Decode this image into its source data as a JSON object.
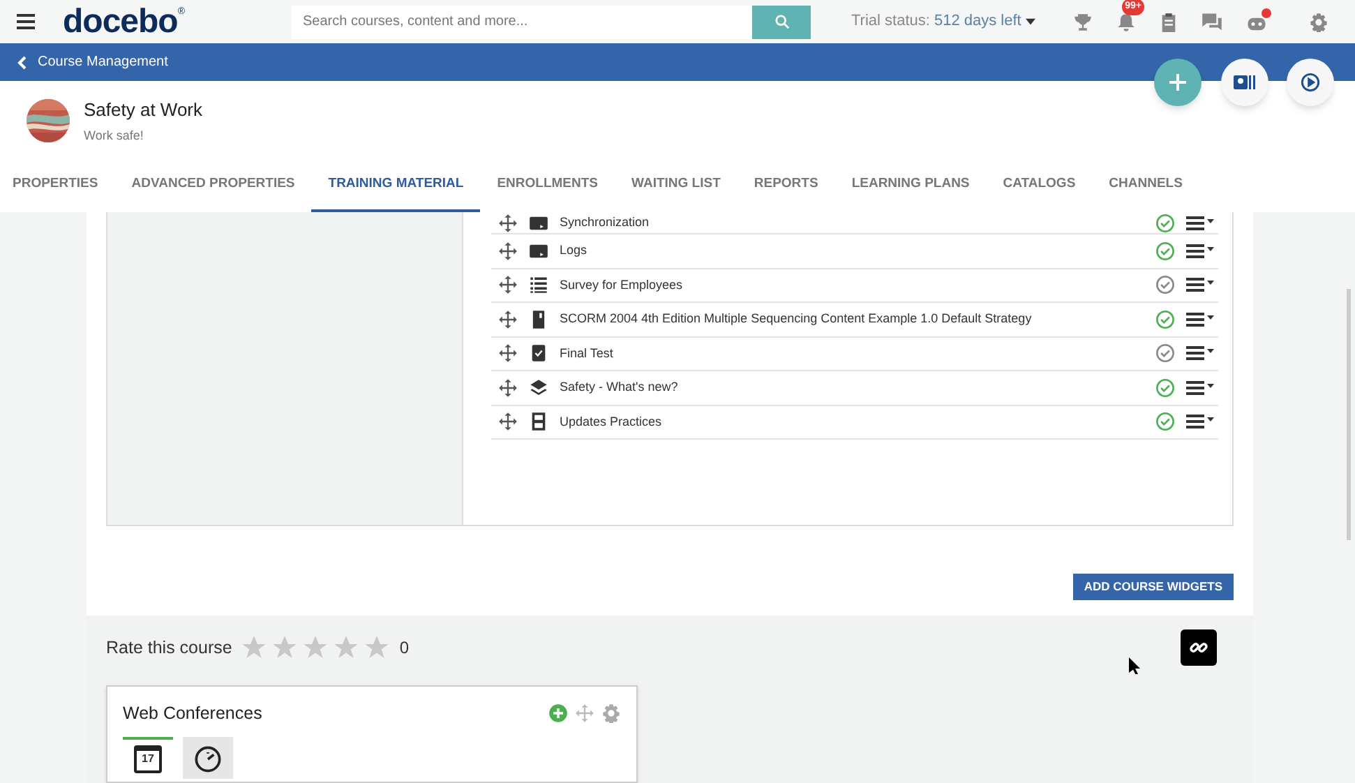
{
  "topbar": {
    "logo": "docebo",
    "logo_mark": "®",
    "search": {
      "placeholder": "Search courses, content and more..."
    },
    "trial_label": "Trial status:",
    "trial_value": "512 days left",
    "notification_badge": "99+"
  },
  "breadcrumb": {
    "label": "Course Management"
  },
  "course": {
    "title": "Safety at Work",
    "subtitle": "Work safe!"
  },
  "tabs": [
    {
      "label": "PROPERTIES",
      "selected": false
    },
    {
      "label": "ADVANCED PROPERTIES",
      "selected": false
    },
    {
      "label": "TRAINING MATERIAL",
      "selected": true
    },
    {
      "label": "ENROLLMENTS",
      "selected": false
    },
    {
      "label": "WAITING LIST",
      "selected": false
    },
    {
      "label": "REPORTS",
      "selected": false
    },
    {
      "label": "LEARNING PLANS",
      "selected": false
    },
    {
      "label": "CATALOGS",
      "selected": false
    },
    {
      "label": "CHANNELS",
      "selected": false
    }
  ],
  "materials": [
    {
      "title": "Synchronization",
      "kind": "screen",
      "completed": true
    },
    {
      "title": "Logs",
      "kind": "screen",
      "completed": true
    },
    {
      "title": "Survey for Employees",
      "kind": "list",
      "completed": false
    },
    {
      "title": "SCORM 2004 4th Edition Multiple Sequencing Content Example 1.0 Default Strategy",
      "kind": "package",
      "completed": true
    },
    {
      "title": "Final Test",
      "kind": "test",
      "completed": false
    },
    {
      "title": "Safety - What's new?",
      "kind": "layers",
      "completed": true
    },
    {
      "title": "Updates Practices",
      "kind": "video",
      "completed": true
    }
  ],
  "add_widgets_button": "ADD COURSE WIDGETS",
  "rating": {
    "label": "Rate this course",
    "stars": 0,
    "count": "0"
  },
  "widget": {
    "title": "Web Conferences",
    "tabs": [
      {
        "kind": "calendar",
        "day": "17",
        "selected": true
      },
      {
        "kind": "clock",
        "selected": false
      }
    ]
  }
}
